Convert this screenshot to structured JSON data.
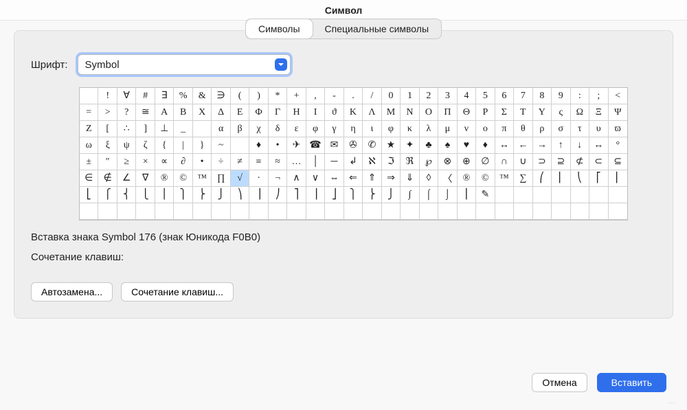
{
  "title": "Символ",
  "tabs": {
    "symbols": "Символы",
    "special": "Специальные символы"
  },
  "font_label": "Шрифт:",
  "font_value": "Symbol",
  "info_line": "Вставка знака Symbol 176 (знак Юникода F0B0)",
  "shortcut_label": "Сочетание клавиш:",
  "buttons": {
    "autocorrect": "Автозамена...",
    "shortcut": "Сочетание клавиш...",
    "cancel": "Отмена",
    "insert": "Вставить"
  },
  "selected_index": 153,
  "chart_data": {
    "type": "table",
    "cols": 29,
    "rows": 8,
    "cells": [
      "",
      "!",
      "∀",
      "#",
      "∃",
      "%",
      "&",
      "∋",
      "(",
      ")",
      "*",
      "+",
      ",",
      "-",
      ".",
      "/",
      "0",
      "1",
      "2",
      "3",
      "4",
      "5",
      "6",
      "7",
      "8",
      "9",
      ":",
      ";",
      "<",
      "=",
      ">",
      "?",
      "≅",
      "Α",
      "Β",
      "Χ",
      "Δ",
      "Ε",
      "Φ",
      "Γ",
      "Η",
      "Ι",
      "ϑ",
      "Κ",
      "Λ",
      "Μ",
      "Ν",
      "Ο",
      "Π",
      "Θ",
      "Ρ",
      "Σ",
      "Τ",
      "Υ",
      "ς",
      "Ω",
      "Ξ",
      "Ψ",
      "Ζ",
      "[",
      "∴",
      "]",
      "⊥",
      "_",
      " ",
      "α",
      "β",
      "χ",
      "δ",
      "ε",
      "φ",
      "γ",
      "η",
      "ι",
      "φ",
      "κ",
      "λ",
      "μ",
      "ν",
      "ο",
      "π",
      "θ",
      "ρ",
      "σ",
      "τ",
      "υ",
      "ϖ",
      "ω",
      "ξ",
      "ψ",
      "ζ",
      "{",
      "|",
      "}",
      "~",
      " ",
      "♦",
      "•",
      "✈",
      "☎",
      "✉",
      "✇",
      "✆",
      "★",
      "✦",
      "♣",
      "♠",
      "♥",
      "♦",
      "↔",
      "←",
      "→",
      "↑",
      "↓",
      "↔",
      "°",
      "±",
      "″",
      "≥",
      "×",
      "∝",
      "∂",
      "•",
      "÷",
      "≠",
      "≡",
      "≈",
      "…",
      "│",
      "─",
      "↲",
      "ℵ",
      "ℑ",
      "ℜ",
      "℘",
      "⊗",
      "⊕",
      "∅",
      "∩",
      "∪",
      "⊃",
      "⊇",
      "⊄",
      "⊂",
      "⊆",
      "∈",
      "∉",
      "∠",
      "∇",
      "®",
      "©",
      "™",
      "∏",
      "√",
      "⋅",
      "¬",
      "∧",
      "∨",
      "⇔",
      "⇐",
      "⇑",
      "⇒",
      "⇓",
      "◊",
      "〈",
      "®",
      "©",
      "™",
      "∑",
      "⎛",
      "⎜",
      "⎝",
      "⎡",
      "⎢",
      "⎣",
      "⎧",
      "⎨",
      "⎩",
      "⎪",
      "⎫",
      "⎬",
      "⎭",
      "⎞",
      "⎟",
      "⎠",
      "⎤",
      "⎥",
      "⎦",
      "⎫",
      "⎬",
      "⎭",
      "∫",
      "⌠",
      "⌡",
      "⎮",
      "✎"
    ]
  }
}
